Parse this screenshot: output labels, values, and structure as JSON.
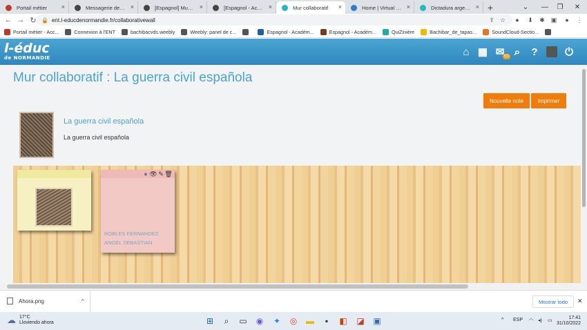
{
  "browser": {
    "tabs": [
      {
        "title": "Portail métier",
        "color": "#c0392b"
      },
      {
        "title": "Messagerie de l'Académie",
        "color": "#444444"
      },
      {
        "title": "[Espagnol] Museo Virtual",
        "color": "#444444"
      },
      {
        "title": "[Espagnol - Académie]",
        "color": "#444444"
      },
      {
        "title": "Mur collaboratif",
        "color": "#22b8c8"
      },
      {
        "title": "Home | Virtual Spanish",
        "color": "#2a7fc9"
      },
      {
        "title": "Dictadura argentina",
        "color": "#1abcc7"
      }
    ],
    "new_tab": "+",
    "url": "ent.l-educdenormandie.fr/collaborativewall",
    "bookmarks": [
      {
        "label": "Portail métier - Acc...",
        "color": "#c0392b"
      },
      {
        "label": "Connexion à l'ENT",
        "color": "#555555"
      },
      {
        "label": "bachibacvds.weebly",
        "color": "#555555"
      },
      {
        "label": "Weebly: panel de c...",
        "color": "#555555"
      },
      {
        "label": "",
        "color": "#555555"
      },
      {
        "label": "Espagnol - Académ...",
        "color": "#1a5fa8"
      },
      {
        "label": "Espagnol - Académ...",
        "color": "#7a3b1a"
      },
      {
        "label": "QuiZinière",
        "color": "#1ab0a5"
      },
      {
        "label": "Bachibar_de_tapas...",
        "color": "#f3b700"
      },
      {
        "label": "SoundCloud-Sectio...",
        "color": "#f26f1f"
      },
      {
        "label": "",
        "color": "#555555"
      }
    ]
  },
  "app": {
    "logo_main": "l-éduc",
    "logo_sub": "de NORMANDIE",
    "mail_count": "63",
    "page_title": "Mur collaboratif : La guerra civil española",
    "buttons": {
      "new_note": "Nouvelle note",
      "print": "Imprimer"
    },
    "wall": {
      "title": "La guerra civil española",
      "description": "La guerra civil española"
    },
    "notes": [
      {
        "color": "#f6f0c3",
        "has_image": true
      },
      {
        "color": "#f2c9c4",
        "author_lines": [
          "ROBLES FERNANDEZ",
          "ANGEL SEBASTIAN"
        ]
      }
    ]
  },
  "download_bar": {
    "file": "Ahora.png",
    "show_all": "Mostrar todo"
  },
  "taskbar": {
    "temperature": "17°C",
    "weather_text": "Lloviendo ahora",
    "language": "ESP",
    "time": "17:41",
    "date": "31/10/2022"
  }
}
